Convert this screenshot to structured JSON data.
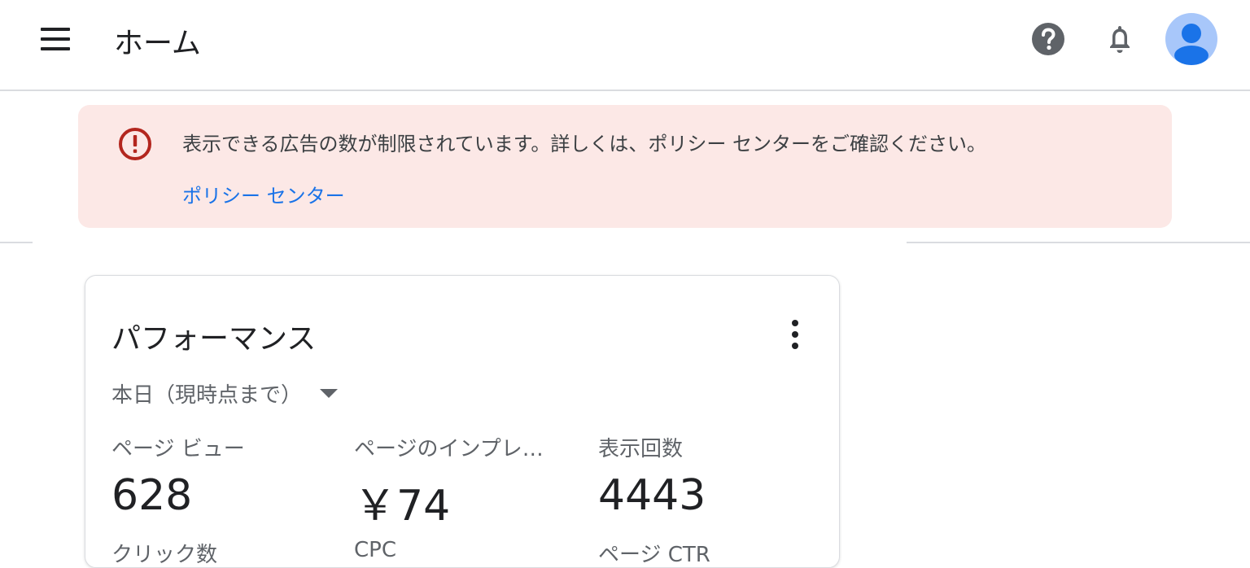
{
  "header": {
    "title": "ホーム",
    "menu_icon": "hamburger-menu-icon",
    "help_icon": "help-circle-icon",
    "notifications_icon": "bell-icon",
    "avatar_icon": "account-avatar-icon"
  },
  "alert": {
    "icon": "error-circle-icon",
    "message": "表示できる広告の数が制限されています。詳しくは、ポリシー センターをご確認ください。",
    "link_label": "ポリシー センター",
    "background_color": "#fce8e6",
    "icon_color": "#b3261e",
    "link_color": "#1a73e8"
  },
  "performance_card": {
    "title": "パフォーマンス",
    "more_icon": "more-vert-icon",
    "date_range": "本日（現時点まで）",
    "metrics": [
      {
        "label": "ページ ビュー",
        "value": "628"
      },
      {
        "label": "ページのインプレ…",
        "value": "￥74"
      },
      {
        "label": "表示回数",
        "value": "4443"
      }
    ],
    "metrics_row2_labels": [
      "クリック数",
      "CPC",
      "ページ CTR"
    ]
  }
}
